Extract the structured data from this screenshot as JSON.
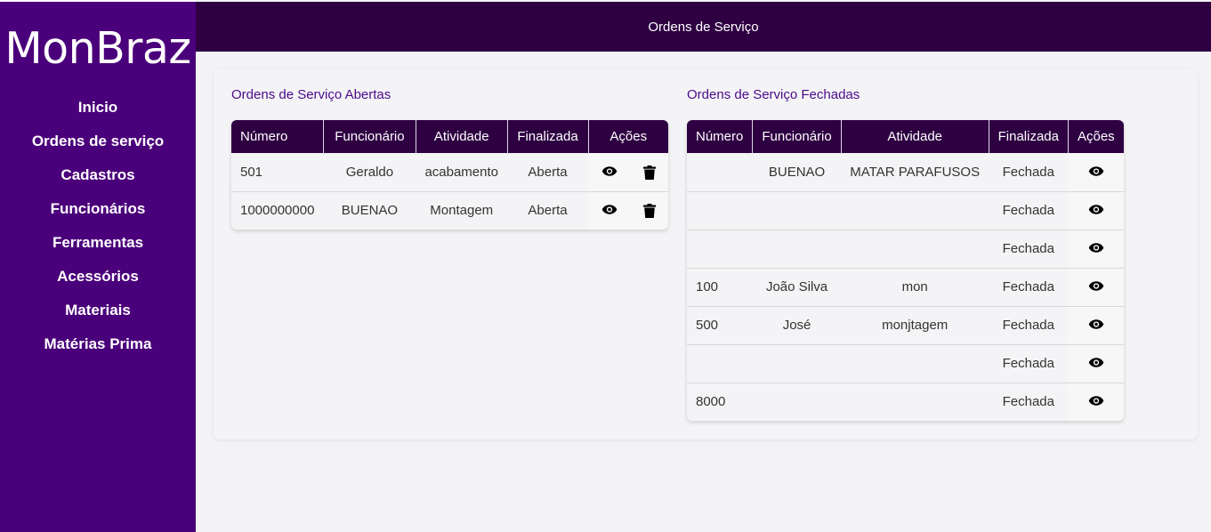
{
  "sidebar": {
    "logo": "MonBraz",
    "items": [
      {
        "label": "Inicio"
      },
      {
        "label": "Ordens de serviço"
      },
      {
        "label": "Cadastros"
      },
      {
        "label": "Funcionários"
      },
      {
        "label": "Ferramentas"
      },
      {
        "label": "Acessórios"
      },
      {
        "label": "Materiais"
      },
      {
        "label": "Matérias Prima"
      }
    ]
  },
  "header": {
    "title": "Ordens de Serviço"
  },
  "open_orders": {
    "title": "Ordens de Serviço Abertas",
    "columns": [
      "Número",
      "Funcionário",
      "Atividade",
      "Finalizada",
      "Ações"
    ],
    "rows": [
      {
        "numero": "501",
        "funcionario": "Geraldo",
        "atividade": "acabamento",
        "finalizada": "Aberta",
        "actions": [
          "eye-icon",
          "trash-icon"
        ]
      },
      {
        "numero": "1000000000",
        "funcionario": "BUENAO",
        "atividade": "Montagem",
        "finalizada": "Aberta",
        "actions": [
          "eye-icon",
          "trash-icon"
        ]
      }
    ]
  },
  "closed_orders": {
    "title": "Ordens de Serviço Fechadas",
    "columns": [
      "Número",
      "Funcionário",
      "Atividade",
      "Finalizada",
      "Ações"
    ],
    "rows": [
      {
        "numero": "",
        "funcionario": "BUENAO",
        "atividade": "MATAR PARAFUSOS",
        "finalizada": "Fechada",
        "actions": [
          "eye-icon"
        ]
      },
      {
        "numero": "",
        "funcionario": "",
        "atividade": "",
        "finalizada": "Fechada",
        "actions": [
          "eye-icon"
        ]
      },
      {
        "numero": "",
        "funcionario": "",
        "atividade": "",
        "finalizada": "Fechada",
        "actions": [
          "eye-icon"
        ]
      },
      {
        "numero": "100",
        "funcionario": "João Silva",
        "atividade": "mon",
        "finalizada": "Fechada",
        "actions": [
          "eye-icon"
        ]
      },
      {
        "numero": "500",
        "funcionario": "José",
        "atividade": "monjtagem",
        "finalizada": "Fechada",
        "actions": [
          "eye-icon"
        ]
      },
      {
        "numero": "",
        "funcionario": "",
        "atividade": "",
        "finalizada": "Fechada",
        "actions": [
          "eye-icon"
        ]
      },
      {
        "numero": "8000",
        "funcionario": "",
        "atividade": "",
        "finalizada": "Fechada",
        "actions": [
          "eye-icon"
        ]
      }
    ]
  },
  "colors": {
    "sidebar_bg": "#4a007a",
    "header_bg": "#2e0042",
    "section_title": "#4a0a8a"
  }
}
